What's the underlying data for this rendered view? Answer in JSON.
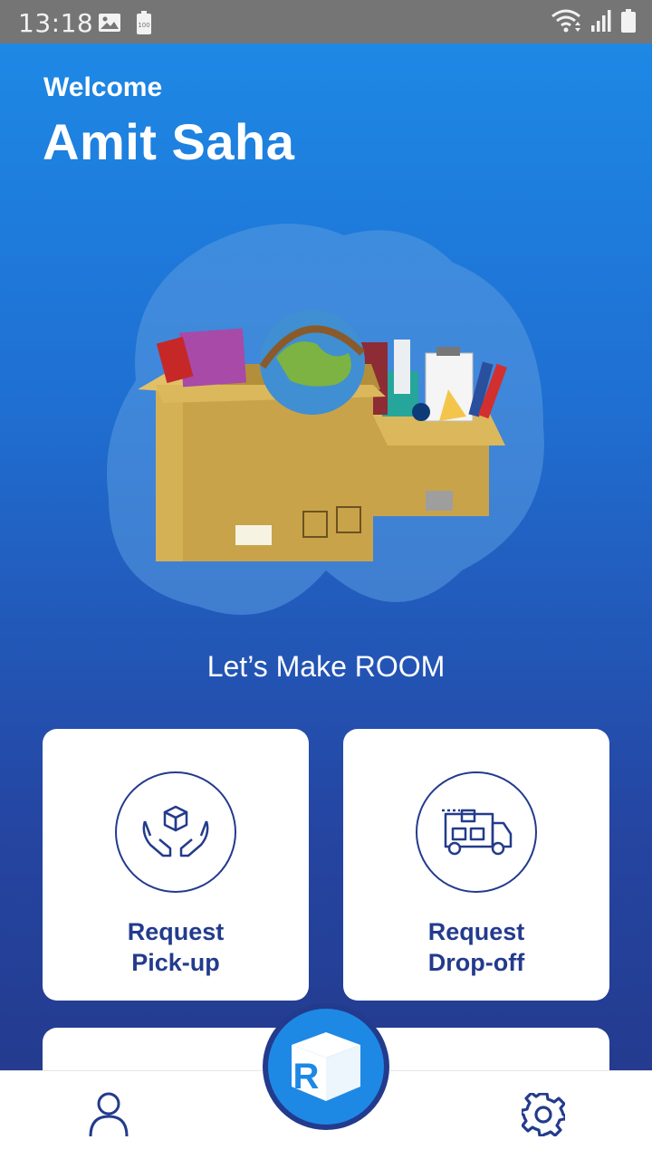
{
  "status_bar": {
    "time": "13:18",
    "battery_label": "100",
    "icons": [
      "image-icon",
      "battery-saver-icon",
      "wifi-icon",
      "signal-icon",
      "battery-icon"
    ]
  },
  "header": {
    "welcome": "Welcome",
    "user_name": "Amit Saha"
  },
  "hero": {
    "illustration": "moving-boxes-illustration"
  },
  "tagline": "Let’s Make  ROOM",
  "cards": {
    "pickup": {
      "line1": "Request",
      "line2": "Pick-up",
      "icon": "hands-box-icon"
    },
    "dropoff": {
      "line1": "Request",
      "line2": "Drop-off",
      "icon": "delivery-truck-icon"
    }
  },
  "bottom_nav": {
    "left_icon": "profile-icon",
    "center_icon": "room-logo-icon",
    "logo_letter": "R",
    "right_icon": "settings-icon"
  },
  "colors": {
    "primary": "#1e88e5",
    "navy": "#233b8c",
    "status_bar": "#757575",
    "card": "#ffffff"
  }
}
